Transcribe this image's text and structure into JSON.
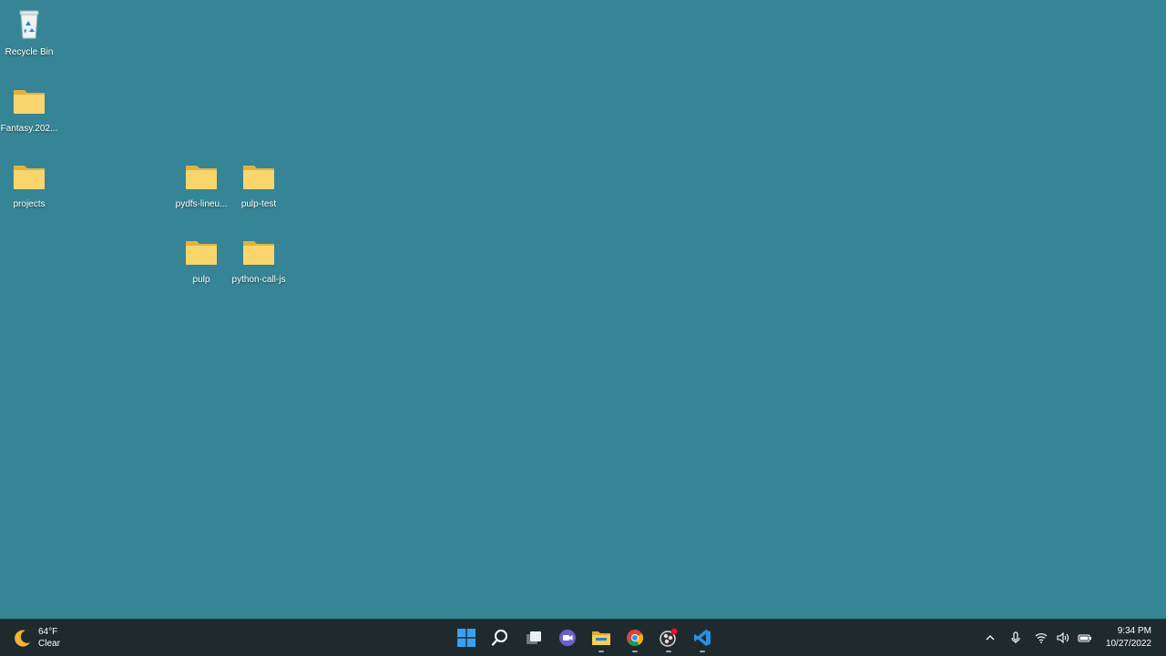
{
  "desktop": {
    "background_color": "#368597",
    "icons": [
      {
        "label": "Recycle Bin",
        "icon": "recycle-bin-icon"
      },
      {
        "label": "Fantasy.202...",
        "icon": "folder-icon"
      },
      {
        "label": "projects",
        "icon": "folder-icon"
      },
      {
        "label": "pydfs-lineu...",
        "icon": "folder-icon"
      },
      {
        "label": "pulp-test",
        "icon": "folder-icon"
      },
      {
        "label": "pulp",
        "icon": "folder-icon"
      },
      {
        "label": "python-call-js",
        "icon": "folder-icon"
      }
    ]
  },
  "taskbar": {
    "weather": {
      "temp": "64°F",
      "condition": "Clear",
      "icon": "moon-icon"
    },
    "apps": [
      {
        "name": "start",
        "icon": "windows-start-icon"
      },
      {
        "name": "search",
        "icon": "search-icon"
      },
      {
        "name": "task-view",
        "icon": "task-view-icon"
      },
      {
        "name": "teams-chat",
        "icon": "chat-camera-icon"
      },
      {
        "name": "file-explorer",
        "icon": "file-explorer-icon"
      },
      {
        "name": "chrome",
        "icon": "chrome-icon"
      },
      {
        "name": "obs",
        "icon": "obs-icon"
      },
      {
        "name": "vscode",
        "icon": "vscode-icon"
      }
    ],
    "tray": {
      "icons": [
        "chevron-up-icon",
        "microphone-icon",
        "wifi-icon",
        "volume-icon",
        "battery-icon"
      ],
      "time": "9:34 PM",
      "date": "10/27/2022"
    }
  }
}
